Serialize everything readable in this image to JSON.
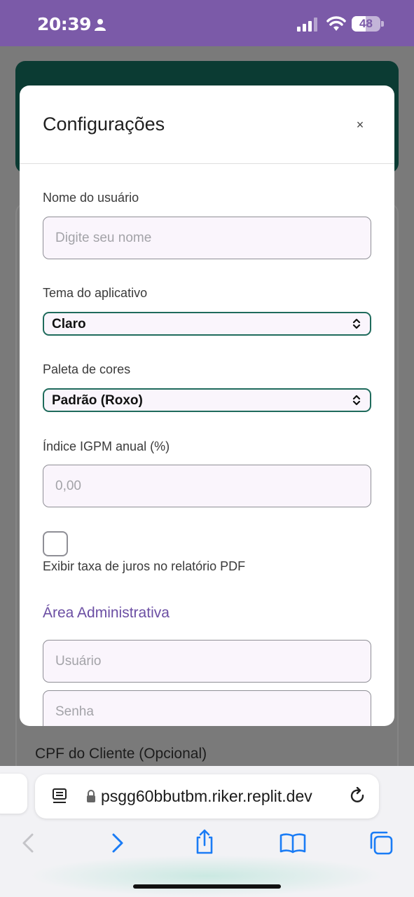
{
  "status_bar": {
    "time": "20:39",
    "battery": "48",
    "battery_fraction": 0.48,
    "icons": [
      "person-icon",
      "signal-icon",
      "wifi-icon",
      "battery-icon"
    ]
  },
  "background": {
    "cpf_label": "CPF do Cliente (Opcional)"
  },
  "modal": {
    "title": "Configurações",
    "close_label": "×",
    "username": {
      "label": "Nome do usuário",
      "placeholder": "Digite seu nome",
      "value": ""
    },
    "theme": {
      "label": "Tema do aplicativo",
      "value": "Claro"
    },
    "palette": {
      "label": "Paleta de cores",
      "value": "Padrão (Roxo)"
    },
    "igpm": {
      "label": "Índice IGPM anual (%)",
      "placeholder": "0,00",
      "value": ""
    },
    "show_interest": {
      "label": "Exibir taxa de juros no relatório PDF",
      "checked": false
    },
    "admin": {
      "title": "Área Administrativa",
      "user_placeholder": "Usuário",
      "password_placeholder": "Senha"
    }
  },
  "browser": {
    "url": "psgg60bbutbm.riker.replit.dev",
    "toolbar": [
      "back-icon",
      "forward-icon",
      "share-icon",
      "bookmarks-icon",
      "tabs-icon"
    ]
  },
  "colors": {
    "status_bar": "#7b5aa8",
    "accent_purple": "#6b4ea3",
    "select_border": "#1f6b5c",
    "header_dark_green": "#0b3b33",
    "ios_blue": "#1a7cf5"
  }
}
